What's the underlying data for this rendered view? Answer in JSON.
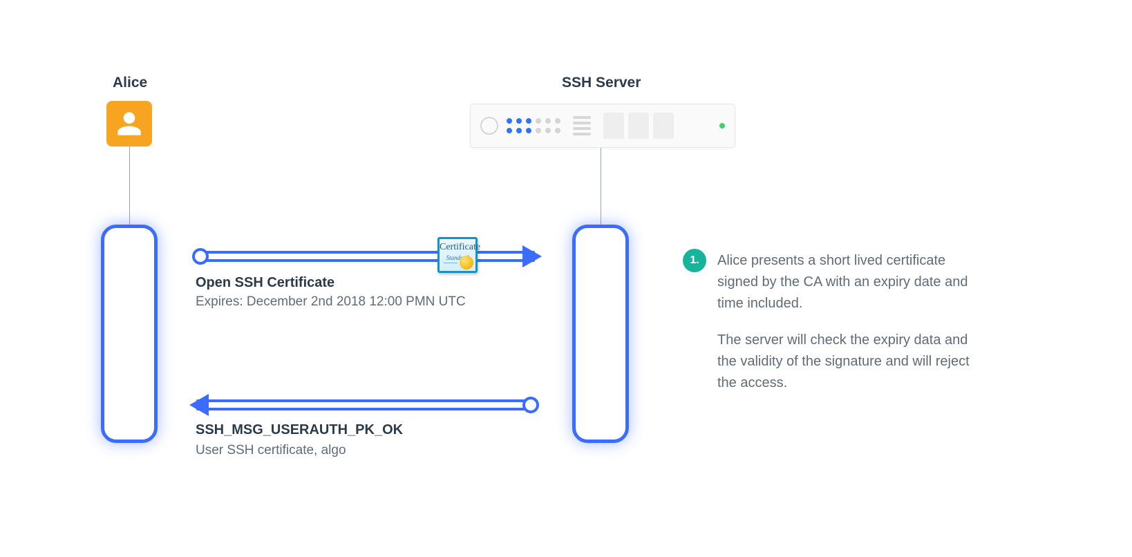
{
  "actors": {
    "alice": {
      "title": "Alice"
    },
    "server": {
      "title": "SSH Server"
    }
  },
  "flows": {
    "request": {
      "title": "Open SSH Certificate",
      "subtitle": "Expires: December 2nd 2018 12:00 PMN UTC",
      "badge": {
        "word": "Certificate",
        "sub": "Standard"
      }
    },
    "response": {
      "title": "SSH_MSG_USERAUTH_PK_OK",
      "subtitle": "User SSH certificate, algo"
    }
  },
  "step": {
    "number": "1.",
    "para1": "Alice presents a short lived certificate signed by the CA with an expiry date and time included.",
    "para2": "The server will check the expiry data and the validity of the signature and will reject the access."
  }
}
